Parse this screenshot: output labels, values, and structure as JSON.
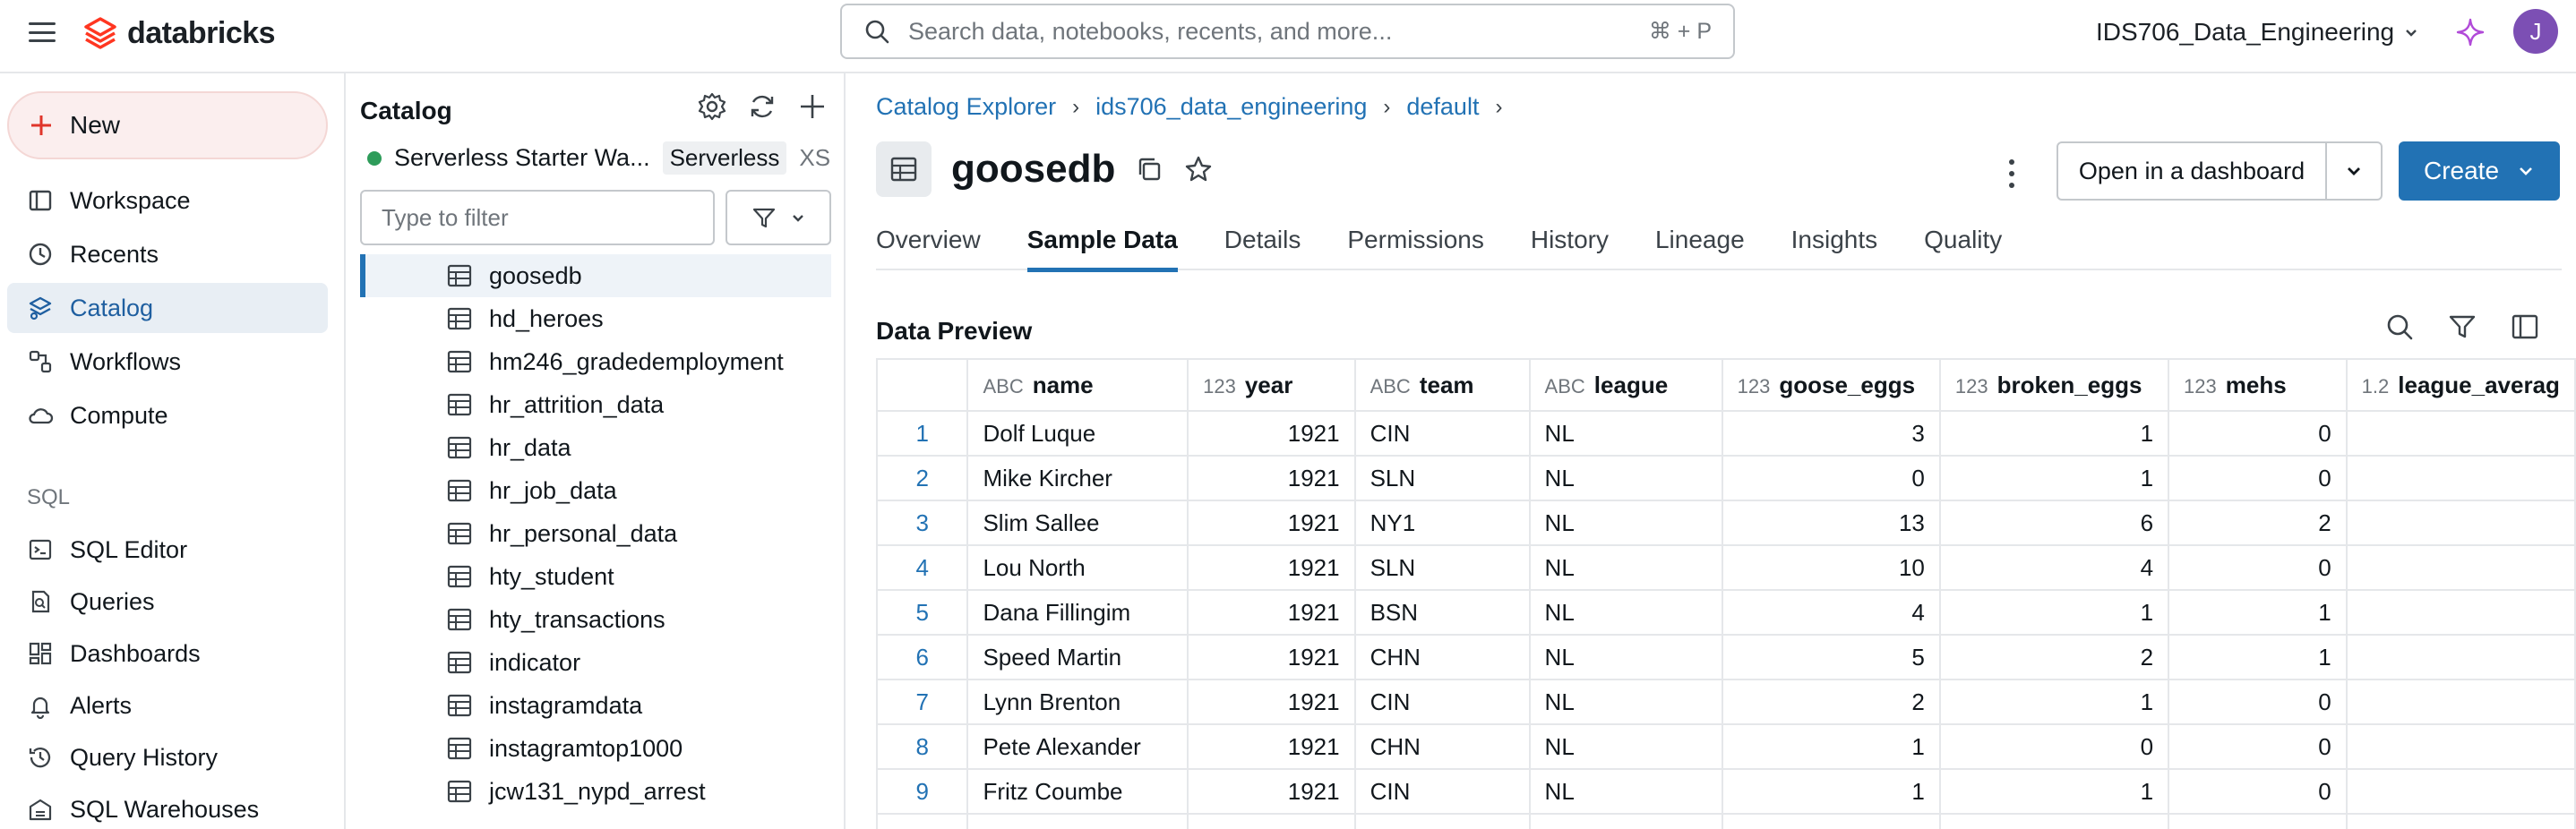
{
  "topbar": {
    "logo_text": "databricks",
    "search_placeholder": "Search data, notebooks, recents, and more...",
    "search_shortcut": "⌘ + P",
    "workspace": "IDS706_Data_Engineering",
    "avatar_initial": "J",
    "brand_color": "#ff3621",
    "avatar_color": "#7c4fb4"
  },
  "leftnav": {
    "new_label": "New",
    "items": [
      {
        "label": "Workspace",
        "icon": "workspace-icon"
      },
      {
        "label": "Recents",
        "icon": "clock-icon"
      },
      {
        "label": "Catalog",
        "icon": "catalog-icon",
        "active": true
      },
      {
        "label": "Workflows",
        "icon": "workflows-icon"
      },
      {
        "label": "Compute",
        "icon": "cloud-icon"
      }
    ],
    "sql_section": "SQL",
    "sql_items": [
      {
        "label": "SQL Editor",
        "icon": "sql-editor-icon"
      },
      {
        "label": "Queries",
        "icon": "queries-icon"
      },
      {
        "label": "Dashboards",
        "icon": "dashboards-icon"
      },
      {
        "label": "Alerts",
        "icon": "bell-icon"
      },
      {
        "label": "Query History",
        "icon": "history-icon"
      },
      {
        "label": "SQL Warehouses",
        "icon": "warehouse-icon"
      }
    ]
  },
  "catalog": {
    "title": "Catalog",
    "warehouse_name": "Serverless Starter Wa...",
    "warehouse_type": "Serverless",
    "warehouse_size": "XS",
    "filter_placeholder": "Type to filter",
    "tables": [
      "goosedb",
      "hd_heroes",
      "hm246_gradedemployment",
      "hr_attrition_data",
      "hr_data",
      "hr_job_data",
      "hr_personal_data",
      "hty_student",
      "hty_transactions",
      "indicator",
      "instagramdata",
      "instagramtop1000",
      "jcw131_nypd_arrest"
    ]
  },
  "main": {
    "breadcrumbs": [
      "Catalog Explorer",
      "ids706_data_engineering",
      "default"
    ],
    "title": "goosedb",
    "open_dashboard": "Open in a dashboard",
    "create": "Create",
    "tabs": [
      "Overview",
      "Sample Data",
      "Details",
      "Permissions",
      "History",
      "Lineage",
      "Insights",
      "Quality"
    ],
    "active_tab": "Sample Data",
    "preview_title": "Data Preview",
    "columns": [
      {
        "type": "ABC",
        "name": "name"
      },
      {
        "type": "123",
        "name": "year"
      },
      {
        "type": "ABC",
        "name": "team"
      },
      {
        "type": "ABC",
        "name": "league"
      },
      {
        "type": "123",
        "name": "goose_eggs"
      },
      {
        "type": "123",
        "name": "broken_eggs"
      },
      {
        "type": "123",
        "name": "mehs"
      },
      {
        "type": "1.2",
        "name": "league_averag"
      }
    ],
    "rows": [
      {
        "idx": "1",
        "cells": [
          "Dolf Luque",
          "1921",
          "CIN",
          "NL",
          "3",
          "1",
          "0",
          ""
        ]
      },
      {
        "idx": "2",
        "cells": [
          "Mike Kircher",
          "1921",
          "SLN",
          "NL",
          "0",
          "1",
          "0",
          ""
        ]
      },
      {
        "idx": "3",
        "cells": [
          "Slim Sallee",
          "1921",
          "NY1",
          "NL",
          "13",
          "6",
          "2",
          ""
        ]
      },
      {
        "idx": "4",
        "cells": [
          "Lou North",
          "1921",
          "SLN",
          "NL",
          "10",
          "4",
          "0",
          ""
        ]
      },
      {
        "idx": "5",
        "cells": [
          "Dana Fillingim",
          "1921",
          "BSN",
          "NL",
          "4",
          "1",
          "1",
          ""
        ]
      },
      {
        "idx": "6",
        "cells": [
          "Speed Martin",
          "1921",
          "CHN",
          "NL",
          "5",
          "2",
          "1",
          ""
        ]
      },
      {
        "idx": "7",
        "cells": [
          "Lynn Brenton",
          "1921",
          "CIN",
          "NL",
          "2",
          "1",
          "0",
          ""
        ]
      },
      {
        "idx": "8",
        "cells": [
          "Pete Alexander",
          "1921",
          "CHN",
          "NL",
          "1",
          "0",
          "0",
          ""
        ]
      },
      {
        "idx": "9",
        "cells": [
          "Fritz Coumbe",
          "1921",
          "CIN",
          "NL",
          "1",
          "1",
          "0",
          ""
        ]
      }
    ]
  }
}
